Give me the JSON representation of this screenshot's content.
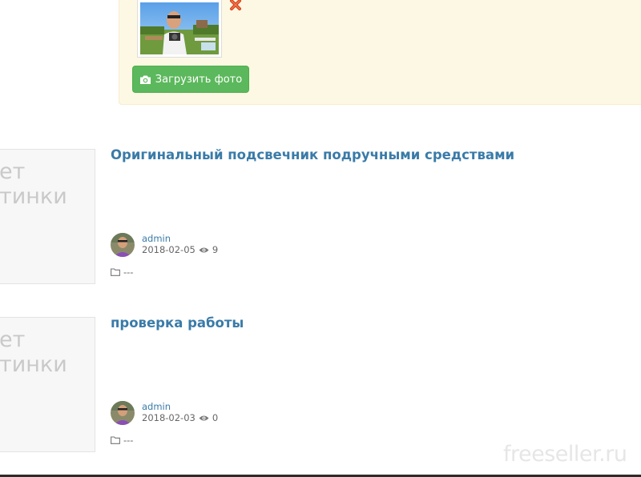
{
  "upload": {
    "button_label": "Загрузить фото"
  },
  "posts": [
    {
      "title": "Оригинальный подсвечник подручными средствами",
      "no_image_text": "ет\nтинки",
      "author": "admin",
      "date": "2018-02-05",
      "views": "9",
      "category": "---"
    },
    {
      "title": "проверка работы",
      "no_image_text": "ет\nтинки",
      "author": "admin",
      "date": "2018-02-03",
      "views": "0",
      "category": "---"
    }
  ],
  "watermark": "freeseller.ru",
  "colors": {
    "link": "#3a7ba8",
    "success": "#5cb85c",
    "warning_bg": "#fcf8e3"
  }
}
